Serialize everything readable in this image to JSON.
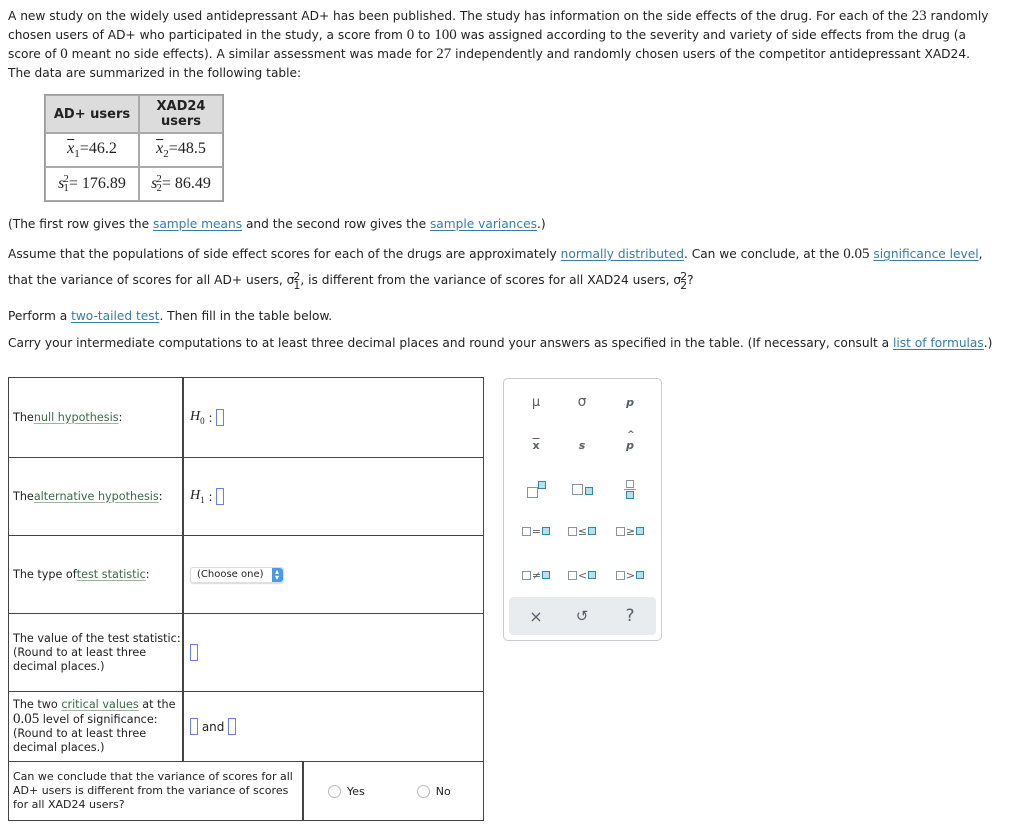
{
  "intro": {
    "line1": "A new study on the widely used antidepressant AD+ has been published. The study has information on the side effects of the drug. For each of the ",
    "n1": "23",
    "line1_end": " randomly",
    "line2a": "chosen users of AD+ who participated in the study, a score from ",
    "zero": "0",
    "to": " to ",
    "hundred": "100",
    "line2b": " was assigned according to the severity and variety of side effects from the drug (a",
    "line3a": "score of ",
    "line3b": " meant no side effects). A similar assessment was made for ",
    "n2": "27",
    "line3c": " independently and randomly chosen users of the competitor antidepressant XAD24.",
    "line4": "The data are summarized in the following table:"
  },
  "data_table": {
    "headers": [
      "AD+ users",
      "XAD24 users"
    ],
    "mean_symbol": "x",
    "variance_symbol": "s",
    "mean1": "46.2",
    "mean2": "48.5",
    "var1": "176.89",
    "var2": "86.49"
  },
  "notes": {
    "first_row_a": "(The first row gives the ",
    "sample_means": "sample means",
    "first_row_b": " and the second row gives the ",
    "sample_variances": "sample variances",
    "first_row_c": ".)",
    "assume_a": "Assume that the populations of side effect scores for each of the drugs are approximately ",
    "normally_distributed": "normally distributed",
    "assume_b": ". Can we conclude, at the ",
    "alpha": "0.05",
    "significance_level": "significance level",
    "assume_c": ",",
    "that_a": "that the variance of scores for all AD+ users, ",
    "sigma": "σ",
    "that_b": ", is different from the variance of scores for all XAD24 users, ",
    "that_c": "?",
    "perform_a": "Perform a ",
    "two_tailed_test": "two-tailed test",
    "perform_b": ". Then fill in the table below.",
    "carry_a": "Carry your intermediate computations to at least three decimal places and round your answers as specified in the table. (If necessary, consult a ",
    "list_of_formulas": "list of formulas",
    "carry_b": ".)"
  },
  "answer_table": {
    "null_prefix": "The ",
    "null_link": "null hypothesis",
    "null_suffix": ":",
    "h0": "H",
    "h0_sub": "0",
    "alt_prefix": "The ",
    "alt_link": "alternative hypothesis",
    "alt_suffix": ":",
    "h1": "H",
    "h1_sub": "1",
    "colon": ":",
    "type_prefix": "The type of ",
    "type_link": "test statistic",
    "type_suffix": ":",
    "select_value": "(Choose one)",
    "value_label_1": "The value of the test statistic:",
    "value_label_2": "(Round to at least three",
    "value_label_3": "decimal places.)",
    "crit_prefix": "The two ",
    "crit_link": "critical values",
    "crit_suffix": " at the",
    "crit_alpha": "0.05",
    "crit_level": " level of significance:",
    "crit_round_1": "(Round to at least three",
    "crit_round_2": "decimal places.)",
    "and": "and",
    "conclude_text": "Can we conclude that the variance of scores for all AD+ users is different from the variance of scores for all XAD24 users?",
    "yes": "Yes",
    "no": "No"
  },
  "palette": {
    "symbols": [
      "μ",
      "σ",
      "p",
      "x",
      "s",
      "p"
    ],
    "relations": [
      "=",
      "≤",
      "≥",
      "≠",
      "<",
      ">"
    ],
    "footer": [
      "×",
      "↺",
      "?"
    ],
    "accent": "#2f8ba3"
  }
}
